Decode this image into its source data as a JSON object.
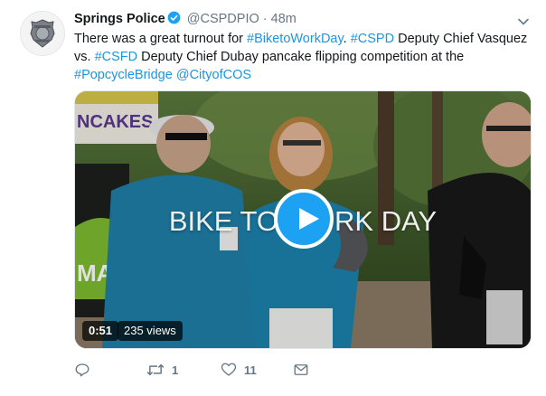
{
  "tweet": {
    "author_name": "Springs Police",
    "handle": "@CSPDPIO",
    "separator": "·",
    "time": "48m",
    "text_parts": [
      {
        "kind": "text",
        "value": "There was a great turnout for "
      },
      {
        "kind": "link",
        "value": "#BiketoWorkDay"
      },
      {
        "kind": "text",
        "value": ". "
      },
      {
        "kind": "link",
        "value": "#CSPD"
      },
      {
        "kind": "text",
        "value": " Deputy Chief Vasquez vs. "
      },
      {
        "kind": "link",
        "value": "#CSFD"
      },
      {
        "kind": "text",
        "value": " Deputy Chief Dubay pancake flipping competition at the "
      },
      {
        "kind": "link",
        "value": "#PopcycleBridge"
      },
      {
        "kind": "text",
        "value": " "
      },
      {
        "kind": "link",
        "value": "@CityofCOS"
      }
    ]
  },
  "media": {
    "video_title": "BIKE TO WORK DAY",
    "banner_text": "NCAKES",
    "side_sign_text": "MA",
    "duration": "0:51",
    "views": "235 views"
  },
  "actions": {
    "reply_count": "",
    "retweet_count": "1",
    "like_count": "11"
  },
  "colors": {
    "link": "#1b95e0",
    "play_button": "#1da1f2",
    "secondary_text": "#657786"
  },
  "icons": [
    "police-badge-icon",
    "verified-icon",
    "chevron-down-icon",
    "play-icon",
    "reply-icon",
    "retweet-icon",
    "like-icon",
    "direct-message-icon"
  ]
}
